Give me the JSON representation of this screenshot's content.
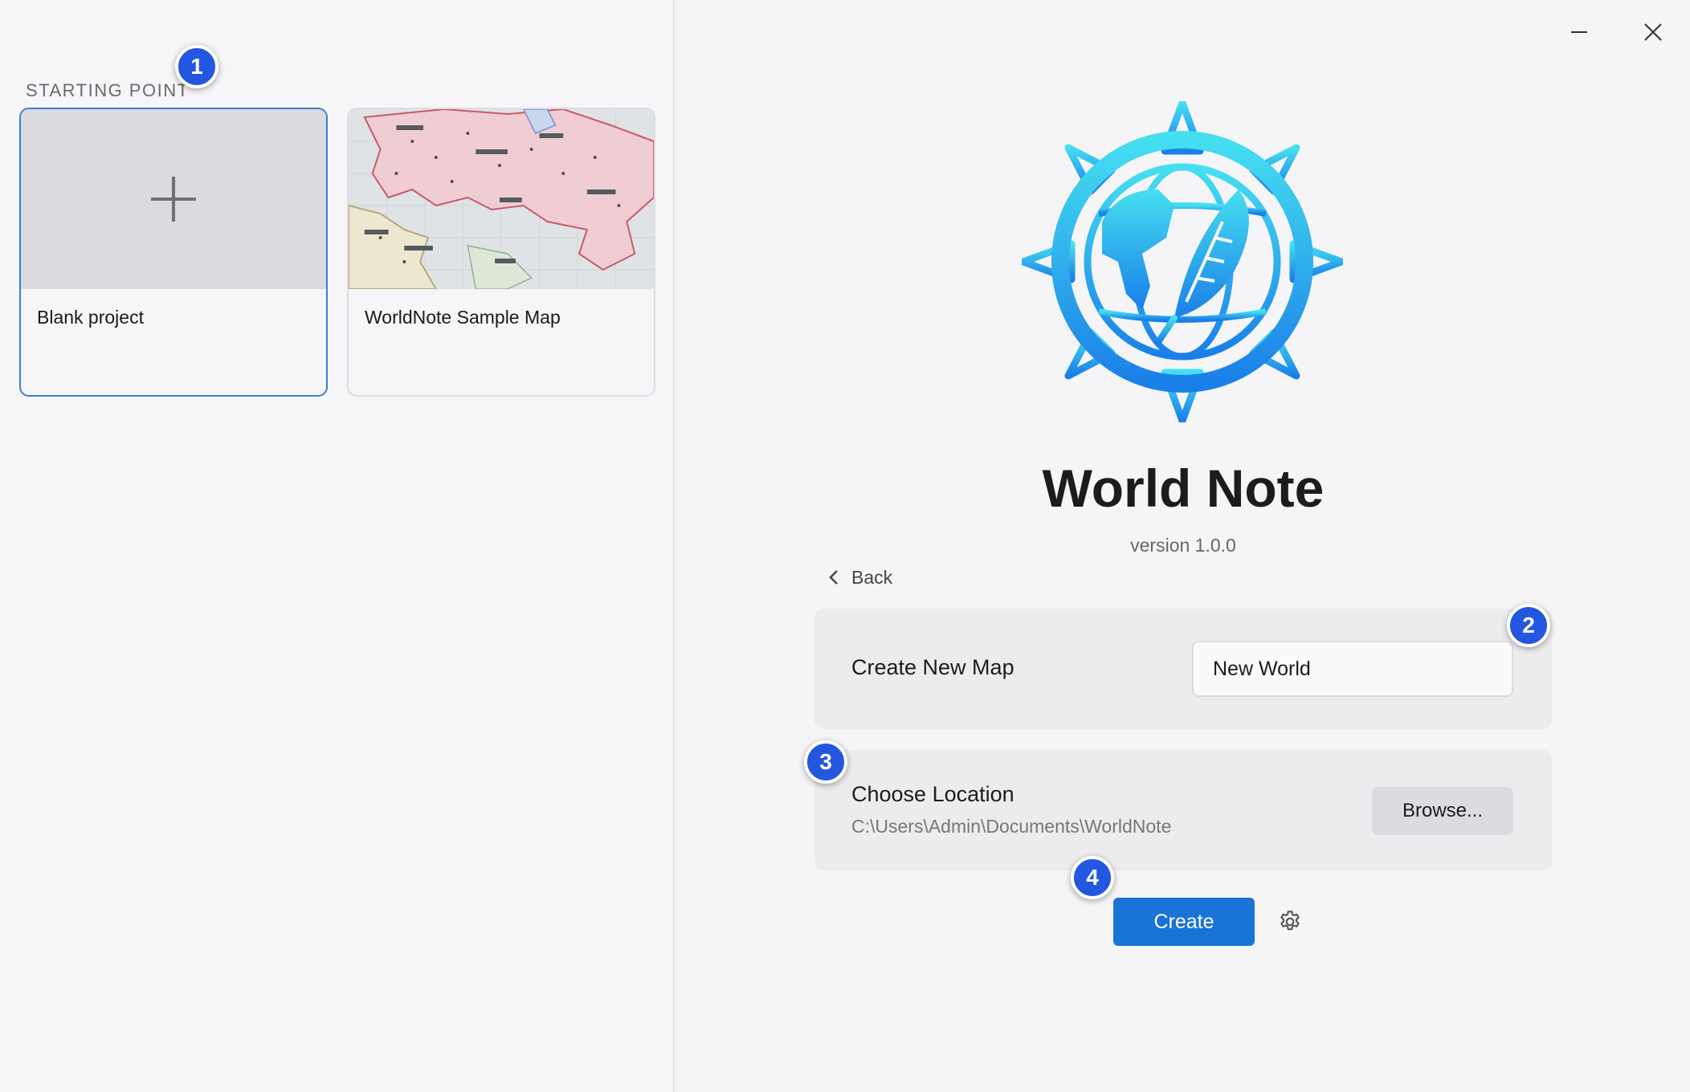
{
  "sidebar": {
    "section_title": "STARTING POINT",
    "cards": [
      {
        "label": "Blank project",
        "selected": true
      },
      {
        "label": "WorldNote Sample Map",
        "selected": false
      }
    ]
  },
  "app": {
    "title": "World Note",
    "version": "version 1.0.0"
  },
  "nav": {
    "back_label": "Back"
  },
  "create_map": {
    "label": "Create New Map",
    "value": "New World"
  },
  "location": {
    "label": "Choose Location",
    "path": "C:\\Users\\Admin\\Documents\\WorldNote",
    "browse_label": "Browse..."
  },
  "actions": {
    "create_label": "Create"
  },
  "badges": [
    "1",
    "2",
    "3",
    "4"
  ],
  "colors": {
    "accent": "#1a73d6",
    "badge": "#2457e0",
    "selected_border": "#3b7fd0",
    "logo_light": "#3fd8f0",
    "logo_dark": "#1a7fe8"
  }
}
